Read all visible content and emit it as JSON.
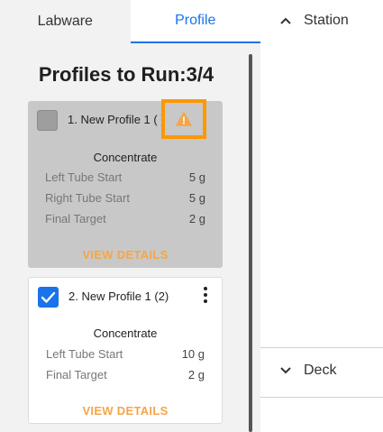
{
  "tabs": [
    {
      "label": "Labware"
    },
    {
      "label": "Profile"
    }
  ],
  "heading": "Profiles to Run:3/4",
  "profiles": [
    {
      "title": "1. New Profile 1 ( )",
      "checked": false,
      "warning_icon": "warning-triangle-icon",
      "section": "Concentrate",
      "rows": [
        {
          "label": "Left Tube Start",
          "value": "5 g"
        },
        {
          "label": "Right Tube Start",
          "value": "5 g"
        },
        {
          "label": "Final Target",
          "value": "2 g"
        }
      ],
      "action": "VIEW DETAILS"
    },
    {
      "title": "2. New Profile 1 (2)",
      "checked": true,
      "section": "Concentrate",
      "rows": [
        {
          "label": "Left Tube Start",
          "value": "10 g"
        },
        {
          "label": "Final Target",
          "value": "2 g"
        }
      ],
      "action": "VIEW DETAILS"
    }
  ],
  "right_panel": {
    "station": {
      "label": "Station",
      "icon": "chevron-up-icon"
    },
    "deck": {
      "label": "Deck",
      "icon": "chevron-down-icon"
    }
  },
  "colors": {
    "accent": "#1a73e8",
    "warning": "#ff9800",
    "action": "#f5a54a"
  }
}
